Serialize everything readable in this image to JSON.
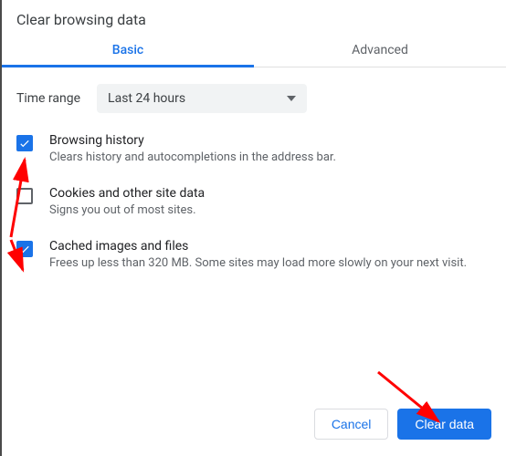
{
  "title": "Clear browsing data",
  "tabs": {
    "basic": "Basic",
    "advanced": "Advanced"
  },
  "time_range": {
    "label": "Time range",
    "value": "Last 24 hours"
  },
  "options": [
    {
      "title": "Browsing history",
      "desc": "Clears history and autocompletions in the address bar.",
      "checked": true
    },
    {
      "title": "Cookies and other site data",
      "desc": "Signs you out of most sites.",
      "checked": false
    },
    {
      "title": "Cached images and files",
      "desc": "Frees up less than 320 MB. Some sites may load more slowly on your next visit.",
      "checked": true
    }
  ],
  "buttons": {
    "cancel": "Cancel",
    "clear": "Clear data"
  },
  "colors": {
    "accent": "#1a73e8",
    "arrow": "#ff0000"
  }
}
